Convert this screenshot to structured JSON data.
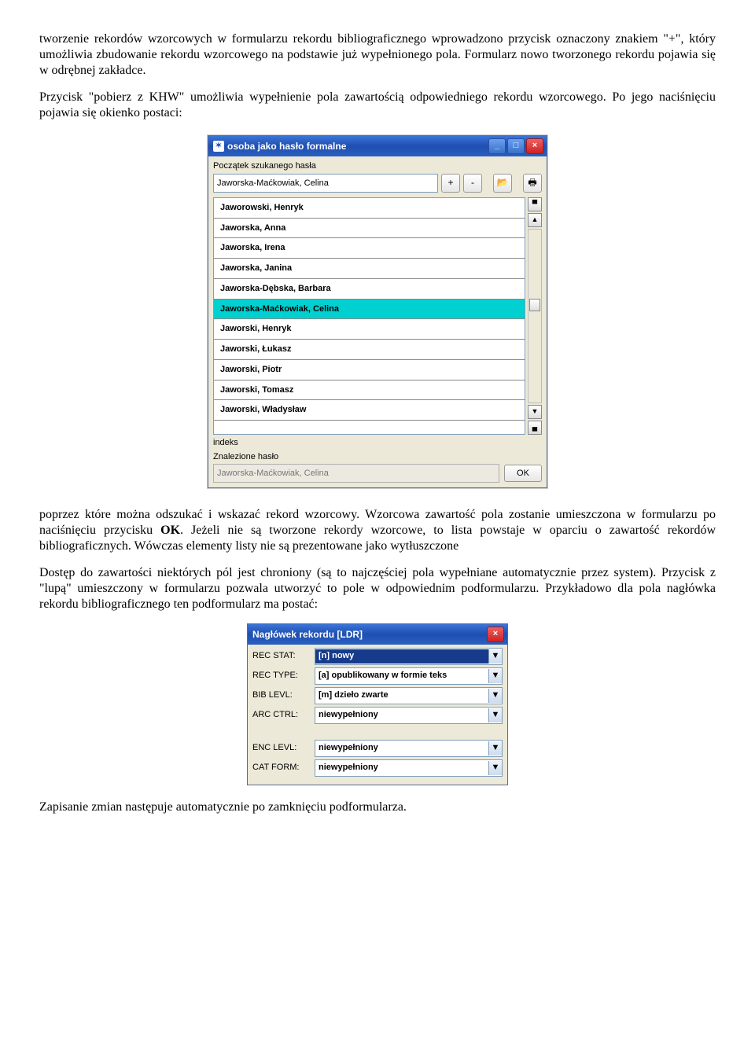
{
  "paragraphs": {
    "p1": "tworzenie rekordów wzorcowych w formularzu rekordu bibliograficznego wprowadzono przycisk oznaczony znakiem \"+\", który umożliwia zbudowanie rekordu wzorcowego na podstawie już wypełnionego pola. Formularz nowo tworzonego rekordu pojawia się w odrębnej zakładce.",
    "p2": "Przycisk \"pobierz z KHW\" umożliwia wypełnienie pola zawartością odpowiedniego rekordu wzorcowego. Po jego naciśnięciu pojawia się okienko postaci:",
    "p3_a": "poprzez które można odszukać i wskazać rekord wzorcowy. Wzorcowa zawartość pola zostanie umieszczona w formularzu po naciśnięciu przycisku ",
    "p3_bold": "OK",
    "p3_b": ". Jeżeli nie są tworzone rekordy wzorcowe, to lista powstaje w oparciu o zawartość rekordów bibliograficznych. Wówczas elementy listy nie są prezentowane jako wytłuszczone",
    "p4": "Dostęp do zawartości niektórych pól jest chroniony (są to najczęściej pola wypełniane automatycznie przez system). Przycisk z \"lupą\" umieszczony w formularzu pozwala utworzyć to pole w odpowiednim podformularzu. Przykładowo dla pola nagłówka rekordu bibliograficznego ten podformularz ma postać:",
    "p5": "Zapisanie zmian następuje automatycznie po zamknięciu podformularza."
  },
  "khw_window": {
    "title": "osoba jako hasło formalne",
    "search_label": "Początek szukanego hasła",
    "search_value": "Jaworska-Maćkowiak, Celina",
    "btn_plus": "+",
    "btn_minus": "-",
    "list": [
      {
        "label": "Jaworowski, Henryk",
        "sel": false
      },
      {
        "label": "Jaworska, Anna",
        "sel": false
      },
      {
        "label": "Jaworska, Irena",
        "sel": false
      },
      {
        "label": "Jaworska, Janina",
        "sel": false
      },
      {
        "label": "Jaworska-Dębska, Barbara",
        "sel": false
      },
      {
        "label": "Jaworska-Maćkowiak, Celina",
        "sel": true
      },
      {
        "label": "Jaworski, Henryk",
        "sel": false
      },
      {
        "label": "Jaworski, Łukasz",
        "sel": false
      },
      {
        "label": "Jaworski, Piotr",
        "sel": false
      },
      {
        "label": "Jaworski, Tomasz",
        "sel": false
      },
      {
        "label": "Jaworski, Władysław",
        "sel": false
      }
    ],
    "index_label": "indeks",
    "found_label": "Znalezione hasło",
    "found_value": "Jaworska-Maćkowiak, Celina",
    "ok_label": "OK"
  },
  "ldr_window": {
    "title": "Nagłówek rekordu [LDR]",
    "rows": [
      {
        "label": "REC STAT:",
        "value": "[n] nowy",
        "active": true
      },
      {
        "label": "REC TYPE:",
        "value": "[a] opublikowany w formie teks",
        "active": false
      },
      {
        "label": "BIB LEVL:",
        "value": "[m] dzieło zwarte",
        "active": false
      },
      {
        "label": "ARC CTRL:",
        "value": "niewypełniony",
        "active": false
      }
    ],
    "rows2": [
      {
        "label": "ENC LEVL:",
        "value": "niewypełniony",
        "active": false
      },
      {
        "label": "CAT FORM:",
        "value": "niewypełniony",
        "active": false
      }
    ]
  }
}
